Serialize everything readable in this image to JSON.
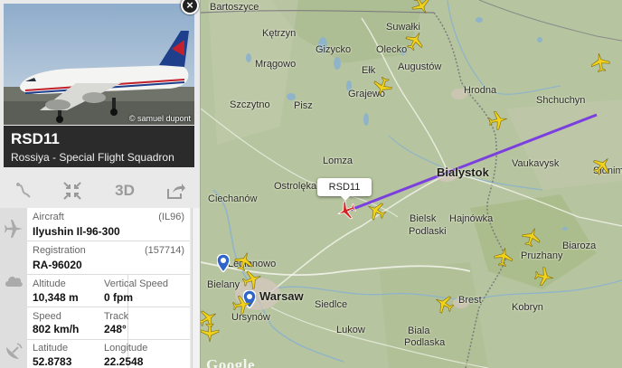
{
  "selected_flight": {
    "callsign": "RSD11",
    "operator": "Rossiya - Special Flight Squadron",
    "photo_credit": "© samuel dupont",
    "map_label": "RSD11"
  },
  "toolbar": {
    "route_icon": "route-icon",
    "fullscreen_icon": "collapse-arrows-icon",
    "view3d_label": "3D",
    "share_icon": "share-icon"
  },
  "details": {
    "aircraft_label": "Aircraft",
    "aircraft_code": "(IL96)",
    "aircraft_value": "Ilyushin Il-96-300",
    "registration_label": "Registration",
    "registration_code": "(157714)",
    "registration_value": "RA-96020",
    "altitude_label": "Altitude",
    "altitude_value": "10,348 m",
    "vspeed_label": "Vertical Speed",
    "vspeed_value": "0 fpm",
    "speed_label": "Speed",
    "speed_value": "802 km/h",
    "track_label": "Track",
    "track_value": "248°",
    "latitude_label": "Latitude",
    "latitude_value": "52.8783",
    "longitude_label": "Longitude",
    "longitude_value": "22.2548"
  },
  "map": {
    "provider_mark": "Google",
    "cities": {
      "bartoszyce": "Bartoszyce",
      "suwalki": "Suwałki",
      "gizycko": "Gizycko",
      "olecko": "Olecko",
      "ketrzyn": "Kętrzyn",
      "mragowo": "Mrągowo",
      "elk": "Ełk",
      "augustow": "Augustów",
      "grajewo": "Grajewo",
      "hrodna": "Hrodna",
      "szczytno": "Szczytno",
      "pisz": "Pisz",
      "shchuchyn": "Shchuchyn",
      "lomza": "Lomza",
      "ostroleka": "Ostrolęka",
      "bialystok": "Bialystok",
      "vaukavysk": "Vaukavysk",
      "slonim": "Slonim",
      "ciechanow": "Ciechanów",
      "bielsk": "Bielsk",
      "podlaski": "Podlaski",
      "hajnowka": "Hajnówka",
      "pruzhany": "Pruzhany",
      "biaroza": "Biaroza",
      "legionowo": "Legionowo",
      "bielany": "Bielany",
      "warsaw": "Warsaw",
      "ursynow": "Ursynów",
      "siedlce": "Siedlce",
      "brest": "Brest",
      "kobryn": "Kobryn",
      "lukow": "Lukow",
      "biala": "Biala",
      "podlaska": "Podlaska"
    },
    "colors": {
      "route": "#7b3fe0",
      "selected_plane": "#d42020",
      "plane": "#f2d21a"
    }
  }
}
